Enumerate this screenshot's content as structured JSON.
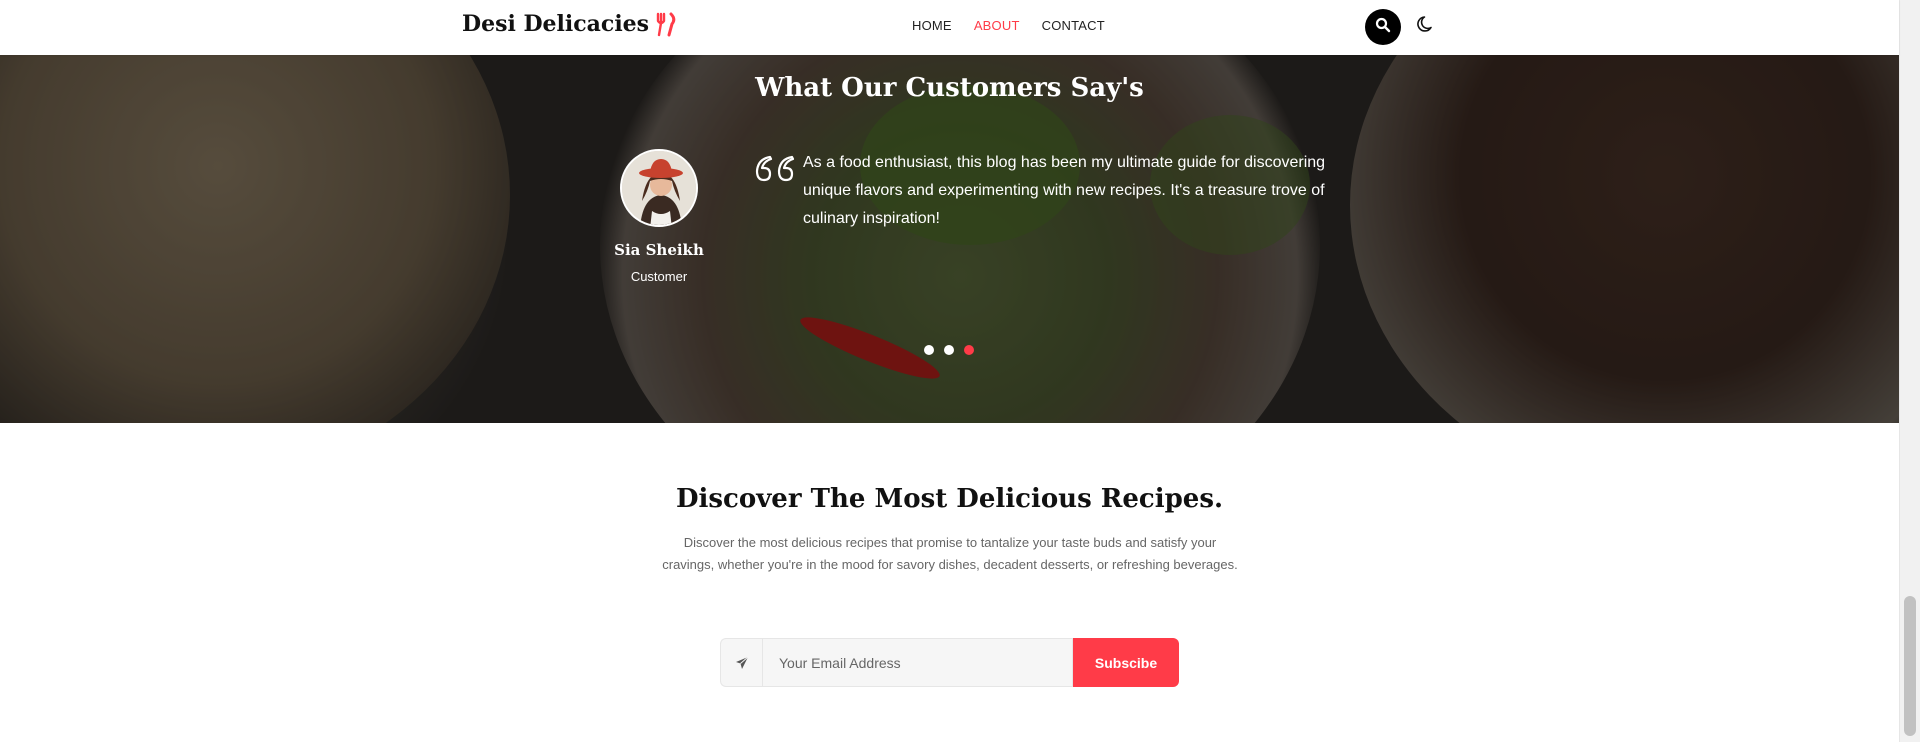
{
  "header": {
    "logo_text": "Desi Delicacies",
    "nav": [
      {
        "label": "HOME",
        "active": false
      },
      {
        "label": "ABOUT",
        "active": true
      },
      {
        "label": "CONTACT",
        "active": false
      }
    ],
    "accent_color": "#ff3b48"
  },
  "testimonial": {
    "title": "What Our Customers Say's",
    "name": "Sia Sheikh",
    "role": "Customer",
    "quote": "As a food enthusiast, this blog has been my ultimate guide for discovering unique flavors and experimenting with new recipes. It's a treasure trove of culinary inspiration!",
    "slides": 3,
    "active_slide": 3
  },
  "discover": {
    "title": "Discover The Most Delicious Recipes.",
    "text": "Discover the most delicious recipes that promise to tantalize your taste buds and satisfy your cravings, whether you're in the mood for savory dishes, decadent desserts, or refreshing beverages.",
    "email_placeholder": "Your Email Address",
    "button_label": "Subscibe"
  }
}
